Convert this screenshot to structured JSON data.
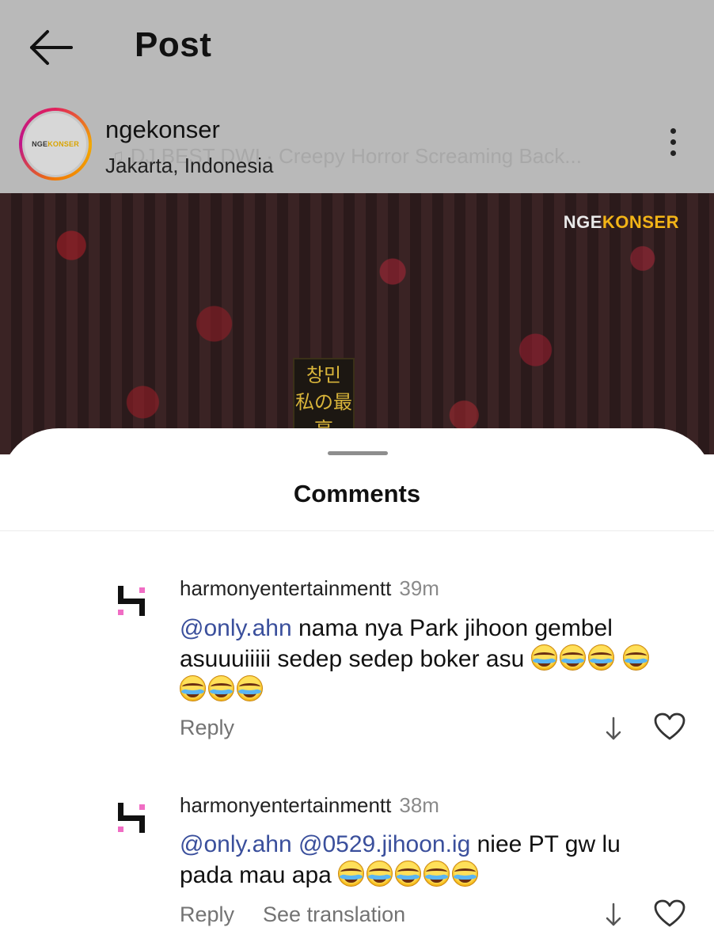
{
  "header": {
    "title": "Post",
    "back_icon": "arrow-left-icon"
  },
  "post": {
    "username": "ngekonser",
    "audio": "♫ DJ BEST DWI · Creepy Horror Screaming Back...",
    "location": "Jakarta, Indonesia",
    "avatar_logo": {
      "part1": "NGE",
      "part2": "KONSER"
    },
    "watermark": {
      "part1": "NGE",
      "part2": "KONSER"
    },
    "banner_text": "창민\n私の最高",
    "more_icon": "more-vertical-icon"
  },
  "sheet": {
    "title": "Comments"
  },
  "comments": [
    {
      "username": "harmonyentertainmentt",
      "time": "39m",
      "mention1": "@only.ahn",
      "text": " nama nya Park jihoon gembel asuuuiiiii sedep sedep  boker asu ",
      "emoji_name": "face-with-tears-of-joy",
      "reply": "Reply"
    },
    {
      "username": "harmonyentertainmentt",
      "time": "38m",
      "mention1": "@only.ahn",
      "mention2": "@0529.jihoon.ig",
      "text": "  niee PT gw lu pada mau apa ",
      "emoji_name": "face-with-tears-of-joy",
      "reply": "Reply",
      "see_translation": "See translation"
    }
  ],
  "colors": {
    "mention": "#3a4f9c",
    "overlay": "#b9b9b9",
    "brand_accent": "#f2b417",
    "logo_pink": "#f06dc4"
  }
}
